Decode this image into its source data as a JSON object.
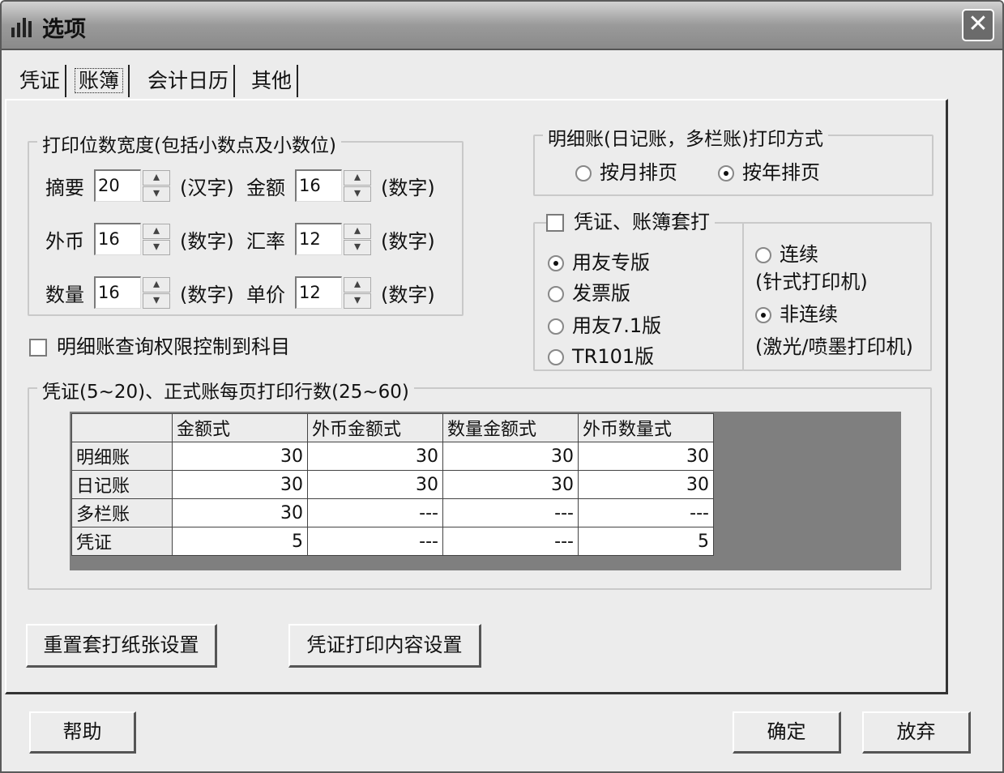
{
  "window": {
    "title": "选项"
  },
  "tabs": [
    {
      "label": "凭证"
    },
    {
      "label": "账簿"
    },
    {
      "label": "会计日历"
    },
    {
      "label": "其他"
    }
  ],
  "print_width": {
    "legend": "打印位数宽度(包括小数点及小数位)",
    "summary_label": "摘要",
    "summary_value": "20",
    "summary_unit": "(汉字)",
    "amount_label": "金额",
    "amount_value": "16",
    "amount_unit": "(数字)",
    "foreign_label": "外币",
    "foreign_value": "16",
    "foreign_unit": "(数字)",
    "rate_label": "汇率",
    "rate_value": "12",
    "rate_unit": "(数字)",
    "qty_label": "数量",
    "qty_value": "16",
    "qty_unit": "(数字)",
    "price_label": "单价",
    "price_value": "12",
    "price_unit": "(数字)"
  },
  "detail_print": {
    "legend": "明细账(日记账，多栏账)打印方式",
    "opt_month": "按月排页",
    "opt_year": "按年排页",
    "selected": "opt_year"
  },
  "overprint": {
    "checkbox_label": "凭证、账簿套打",
    "checked": false,
    "opt_yonyou": "用友专版",
    "opt_invoice": "发票版",
    "opt_yonyou71": "用友7.1版",
    "opt_tr101": "TR101版",
    "selected_style": "opt_yonyou",
    "opt_continuous": "连续",
    "continuous_note": "(针式打印机)",
    "opt_noncontinuous": "非连续",
    "noncontinuous_note": "(激光/喷墨打印机)",
    "selected_paper": "opt_noncontinuous"
  },
  "permission": {
    "label": "明细账查询权限控制到科目",
    "checked": false
  },
  "lines_per_page": {
    "legend": "凭证(5~20)、正式账每页打印行数(25~60)",
    "columns": [
      "",
      "金额式",
      "外币金额式",
      "数量金额式",
      "外币数量式"
    ],
    "rows": [
      {
        "name": "明细账",
        "values": [
          "30",
          "30",
          "30",
          "30"
        ]
      },
      {
        "name": "日记账",
        "values": [
          "30",
          "30",
          "30",
          "30"
        ]
      },
      {
        "name": "多栏账",
        "values": [
          "30",
          "---",
          "---",
          "---"
        ]
      },
      {
        "name": "凭证",
        "values": [
          "5",
          "---",
          "---",
          "5"
        ]
      }
    ]
  },
  "buttons": {
    "reset_overprint": "重置套打纸张设置",
    "voucher_print_content": "凭证打印内容设置",
    "help": "帮助",
    "ok": "确定",
    "cancel": "放弃"
  }
}
